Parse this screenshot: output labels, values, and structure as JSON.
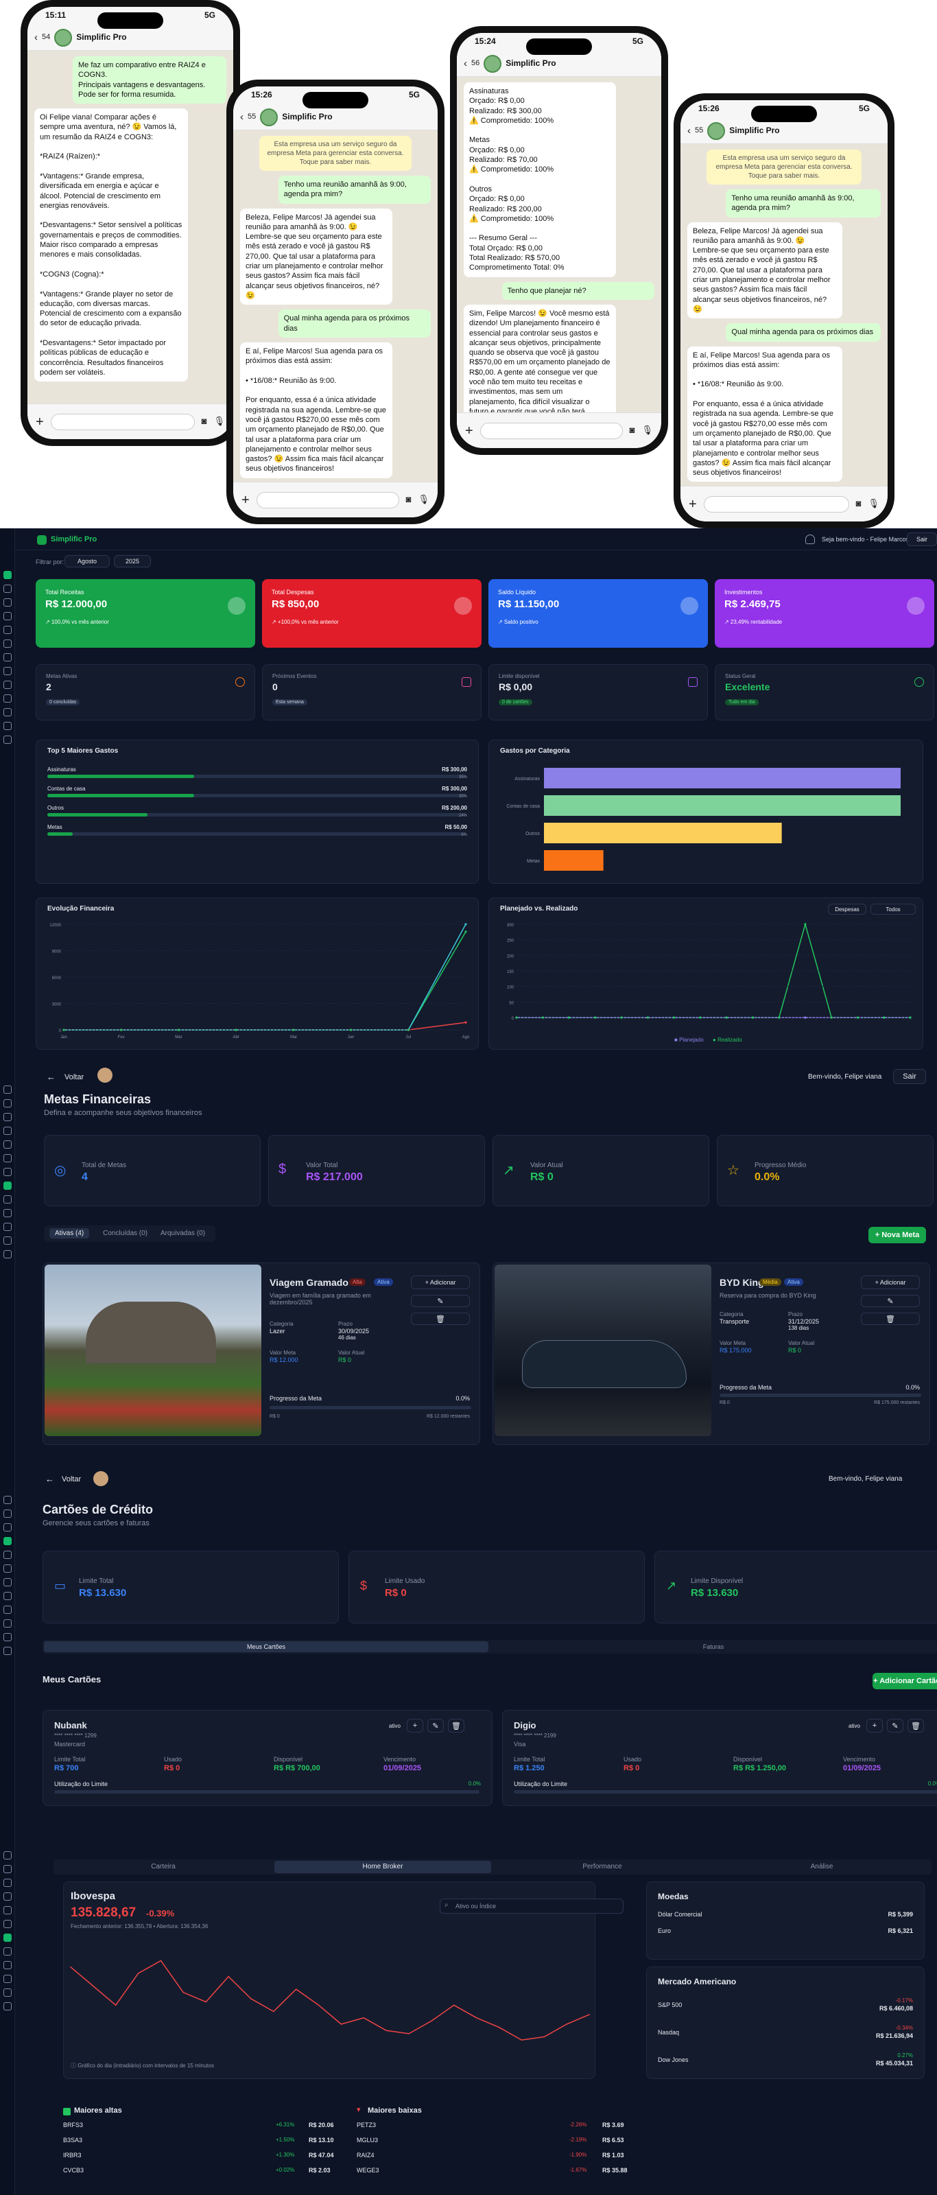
{
  "phones": [
    {
      "time": "15:11",
      "net": "5G",
      "num": "54",
      "name": "Simplific Pro",
      "msgs": [
        {
          "t": "out",
          "x": "Me faz um comparativo entre RAIZ4 e COGN3.\nPrincipais vantagens e desvantagens.\nPode ser for forma resumida."
        },
        {
          "t": "in",
          "x": "Oi Felipe viana! Comparar ações é sempre uma aventura, né? 😉 Vamos lá, um resumão da RAIZ4 e COGN3:\n\n*RAIZ4 (Raízen):*\n\n*Vantagens:* Grande empresa, diversificada em energia e açúcar e álcool. Potencial de crescimento em energias renováveis.\n\n*Desvantagens:* Setor sensível a políticas governamentais e preços de commodities. Maior risco comparado a empresas menores e mais consolidadas.\n\n*COGN3 (Cogna):*\n\n*Vantagens:* Grande player no setor de educação, com diversas marcas. Potencial de crescimento com a expansão do setor de educação privada.\n\n*Desvantagens:* Setor impactado por políticas públicas de educação e concorrência. Resultados financeiros podem ser voláteis."
        }
      ]
    },
    {
      "time": "15:26",
      "net": "5G",
      "num": "55",
      "name": "Simplific Pro",
      "msgs": [
        {
          "t": "sys",
          "x": "Esta empresa usa um serviço seguro da empresa Meta para gerenciar esta conversa. Toque para saber mais."
        },
        {
          "t": "out",
          "x": "Tenho uma reunião amanhã às 9:00, agenda pra mim?"
        },
        {
          "t": "in",
          "x": "Beleza, Felipe Marcos! Já agendei sua reunião para amanhã às 9:00. 😉\nLembre-se que seu orçamento para este mês está zerado e você já gastou R$ 270,00. Que tal usar a plataforma para criar um planejamento e controlar melhor seus gastos? Assim fica mais fácil alcançar seus objetivos financeiros, né? 😉"
        },
        {
          "t": "out",
          "x": "Qual minha agenda para os próximos dias"
        },
        {
          "t": "in",
          "x": "E aí, Felipe Marcos! Sua agenda para os próximos dias está assim:\n\n• *16/08:* Reunião às 9:00.\n\nPor enquanto, essa é a única atividade registrada na sua agenda. Lembre-se que você já gastou R$270,00 esse mês com um orçamento planejado de R$0,00. Que tal usar a plataforma para criar um planejamento e controlar melhor seus gastos? 😉 Assim fica mais fácil alcançar seus objetivos financeiros!"
        }
      ]
    },
    {
      "time": "15:24",
      "net": "5G",
      "num": "56",
      "name": "Simplific Pro",
      "msgs": [
        {
          "t": "in",
          "x": "Assinaturas\n  Orçado: R$ 0,00\n  Realizado: R$ 300,00\n  ⚠️ Comprometido: 100%\n\nMetas\n  Orçado: R$ 0,00\n  Realizado: R$ 70,00\n  ⚠️ Comprometido: 100%\n\nOutros\n  Orçado: R$ 0,00\n  Realizado: R$ 200,00\n  ⚠️ Comprometido: 100%\n\n--- Resumo Geral ---\nTotal Orçado: R$ 0,00\nTotal Realizado: R$ 570,00\nComprometimento Total: 0%"
        },
        {
          "t": "out",
          "x": "Tenho que planejar né?"
        },
        {
          "t": "in",
          "x": "Sim, Felipe Marcos! 😉 Você mesmo está dizendo! Um planejamento financeiro é essencial para controlar seus gastos e alcançar seus objetivos, principalmente quando se observa que você já gastou R$570,00 em um orçamento planejado de R$0,00. A gente até consegue ver que você não tem muito teu receitas e investimentos, mas sem um planejamento, fica difícil visualizar o futuro e garantir que você não terá surpresas desagradáveis. Vamos criar um planejamento na plataforma Simplific para te ajudar a"
        }
      ]
    },
    {
      "time": "15:26",
      "net": "5G",
      "num": "55",
      "name": "Simplific Pro",
      "msgs": [
        {
          "t": "sys",
          "x": "Esta empresa usa um serviço seguro da empresa Meta para gerenciar esta conversa. Toque para saber mais."
        },
        {
          "t": "out",
          "x": "Tenho uma reunião amanhã às 9:00, agenda pra mim?"
        },
        {
          "t": "in",
          "x": "Beleza, Felipe Marcos! Já agendei sua reunião para amanhã às 9:00. 😉\nLembre-se que seu orçamento para este mês está zerado e você já gastou R$ 270,00. Que tal usar a plataforma para criar um planejamento e controlar melhor seus gastos? Assim fica mais fácil alcançar seus objetivos financeiros, né? 😉"
        },
        {
          "t": "out",
          "x": "Qual minha agenda para os próximos dias"
        },
        {
          "t": "in",
          "x": "E aí, Felipe Marcos! Sua agenda para os próximos dias está assim:\n\n• *16/08:* Reunião às 9:00.\n\nPor enquanto, essa é a única atividade registrada na sua agenda. Lembre-se que você já gastou R$270,00 esse mês com um orçamento planejado de R$0,00. Que tal usar a plataforma para criar um planejamento e controlar melhor seus gastos? 😉 Assim fica mais fácil alcançar seus objetivos financeiros!"
        }
      ]
    }
  ],
  "dash": {
    "brand": "Simplific Pro",
    "welcome": "Seja bem-vindo - Felipe Marcos",
    "logout": "Sair",
    "filter_label": "Filtrar por:",
    "month": "Agosto",
    "year": "2025",
    "kpis": [
      {
        "label": "Total Receitas",
        "value": "R$ 12.000,00",
        "note": "↗ 100,0% vs mês anterior",
        "color": "#16a34a"
      },
      {
        "label": "Total Despesas",
        "value": "R$ 850,00",
        "note": "↗ +100,0% vs mês anterior",
        "color": "#e11d2a"
      },
      {
        "label": "Saldo Líquido",
        "value": "R$ 11.150,00",
        "note": "↗ Saldo positivo",
        "color": "#2563eb"
      },
      {
        "label": "Investimentos",
        "value": "R$ 2.469,75",
        "note": "↗ 23,49% rentabilidade",
        "color": "#9333ea"
      }
    ],
    "stats": [
      {
        "label": "Metas Ativas",
        "value": "2",
        "tag": "0 concluídas"
      },
      {
        "label": "Próximos Eventos",
        "value": "0",
        "tag": "Esta semana"
      },
      {
        "label": "Limite disponível",
        "value": "R$ 0,00",
        "tag": "0 de cartões",
        "green": true
      },
      {
        "label": "Status Geral",
        "value": "Excelente",
        "tag": "Tudo em dia",
        "green": true
      }
    ],
    "top_title": "Top 5 Maiores Gastos",
    "top": [
      {
        "name": "Assinaturas",
        "value": "R$ 300,00",
        "pct": "35%",
        "frac": 0.35
      },
      {
        "name": "Contas de casa",
        "value": "R$ 300,00",
        "pct": "35%",
        "frac": 0.35
      },
      {
        "name": "Outros",
        "value": "R$ 200,00",
        "pct": "24%",
        "frac": 0.24
      },
      {
        "name": "Metas",
        "value": "R$ 50,00",
        "pct": "6%",
        "frac": 0.06
      }
    ],
    "cat_title": "Gastos por Categoria",
    "evo_title": "Evolução Financeira",
    "plan_title": "Planejado vs. Realizado",
    "plan_sel1": "Despesas",
    "plan_sel2": "Todos",
    "plan_legend1": "Planejado",
    "plan_legend2": "Realizado"
  },
  "chart_data": [
    {
      "type": "bar",
      "title": "Gastos por Categoria",
      "categories": [
        "Assinaturas",
        "Contas de casa",
        "Outros",
        "Metas"
      ],
      "values": [
        300,
        300,
        200,
        50
      ],
      "colors": [
        "#8b7fe8",
        "#7ed39a",
        "#fccf5a",
        "#f97316"
      ]
    },
    {
      "type": "line",
      "title": "Evolução Financeira",
      "x": [
        "Jan",
        "Fev",
        "Mar",
        "Abr",
        "Mai",
        "Jun",
        "Jul",
        "Ago"
      ],
      "yticks": [
        "12000",
        "9000",
        "6000",
        "3000",
        "0"
      ],
      "ylim": [
        0,
        12000
      ],
      "series": [
        {
          "values": [
            0,
            0,
            0,
            0,
            0,
            0,
            0,
            12000
          ],
          "color": "#3bc6d8"
        },
        {
          "values": [
            0,
            0,
            0,
            0,
            0,
            0,
            0,
            850
          ],
          "color": "#ef4444"
        },
        {
          "values": [
            0,
            0,
            0,
            0,
            0,
            0,
            0,
            11150
          ],
          "color": "#22c55e"
        }
      ]
    },
    {
      "type": "line",
      "title": "Planejado vs. Realizado",
      "ylim": [
        0,
        300
      ],
      "yticks": [
        "300",
        "250",
        "200",
        "150",
        "100",
        "50",
        "0"
      ],
      "series": [
        {
          "name": "Planejado",
          "values": [
            0,
            0,
            0,
            0,
            0,
            0,
            0,
            0,
            0,
            0,
            0,
            0,
            0,
            0,
            0,
            0
          ],
          "color": "#8b7fe8"
        },
        {
          "name": "Realizado",
          "values": [
            0,
            0,
            0,
            0,
            0,
            0,
            0,
            0,
            0,
            0,
            0,
            300,
            0,
            0,
            0,
            0
          ],
          "color": "#22c55e"
        }
      ]
    }
  ],
  "goals": {
    "back": "Voltar",
    "welcome": "Bem-vindo, Felipe viana",
    "logout": "Sair",
    "title": "Metas Financeiras",
    "subtitle": "Defina e acompanhe seus objetivos financeiros",
    "cards": [
      {
        "label": "Total de Metas",
        "value": "4"
      },
      {
        "label": "Valor Total",
        "value": "R$ 217.000"
      },
      {
        "label": "Valor Atual",
        "value": "R$ 0"
      },
      {
        "label": "Progresso Médio",
        "value": "0.0%"
      }
    ],
    "tabs": [
      "Ativas (4)",
      "Concluídas (0)",
      "Arquivadas (0)"
    ],
    "new_btn": "+ Nova Meta",
    "items": [
      {
        "title": "Viagem Gramado",
        "prio": "Alta",
        "status": "Ativa",
        "desc": "Viagem em família para gramado em dezembro/2025",
        "cat_l": "Categoria",
        "cat": "Lazer",
        "prazo_l": "Prazo",
        "prazo": "30/09/2025",
        "dias": "46 dias",
        "vm_l": "Valor Meta",
        "vm": "R$ 12.000",
        "va_l": "Valor Atual",
        "va": "R$ 0",
        "prog_l": "Progresso da Meta",
        "prog": "0.0%",
        "left": "R$ 0",
        "right": "R$ 12.000 restantes",
        "add": "+ Adicionar"
      },
      {
        "title": "BYD King",
        "prio": "Média",
        "status": "Ativa",
        "desc": "Reserva para compra do BYD King",
        "cat_l": "Categoria",
        "cat": "Transporte",
        "prazo_l": "Prazo",
        "prazo": "31/12/2025",
        "dias": "138 dias",
        "vm_l": "Valor Meta",
        "vm": "R$ 175.000",
        "va_l": "Valor Atual",
        "va": "R$ 0",
        "prog_l": "Progresso da Meta",
        "prog": "0.0%",
        "left": "R$ 0",
        "right": "R$ 175.000 restantes",
        "add": "+ Adicionar"
      }
    ]
  },
  "cards": {
    "back": "Voltar",
    "welcome": "Bem-vindo, Felipe viana",
    "title": "Cartões de Crédito",
    "subtitle": "Gerencie seus cartões e faturas",
    "sum": [
      {
        "label": "Limite Total",
        "value": "R$ 13.630"
      },
      {
        "label": "Limite Usado",
        "value": "R$ 0"
      },
      {
        "label": "Limite Disponível",
        "value": "R$ 13.630"
      }
    ],
    "tabs": [
      "Meus Cartões",
      "Faturas"
    ],
    "my": "Meus Cartões",
    "add": "+ Adicionar Cartão",
    "items": [
      {
        "name": "Nubank",
        "num": "**** **** **** 1299",
        "brand": "Mastercard",
        "status": "ativo",
        "lt_l": "Limite Total",
        "lt": "R$ 700",
        "us_l": "Usado",
        "us": "R$ 0",
        "di_l": "Disponível",
        "di": "R$ R$ 700,00",
        "ve_l": "Vencimento",
        "ve": "01/09/2025",
        "util": "Utilização do Limite",
        "pct": "0.0%"
      },
      {
        "name": "Digio",
        "num": "**** **** **** 2199",
        "brand": "Visa",
        "status": "ativo",
        "lt_l": "Limite Total",
        "lt": "R$ 1.250",
        "us_l": "Usado",
        "us": "R$ 0",
        "di_l": "Disponível",
        "di": "R$ R$ 1.250,00",
        "ve_l": "Vencimento",
        "ve": "01/09/2025",
        "util": "Utilização do Limite",
        "pct": "0.0%"
      }
    ]
  },
  "broker": {
    "tabs": [
      "Carteira",
      "Home Broker",
      "Performance",
      "Análise"
    ],
    "index": "Ibovespa",
    "value": "135.828,67",
    "chg": "-0.39%",
    "sub": "Fechamento anterior: 136.355,78 • Abertura: 136.354,36",
    "search_ph": "Ativo ou Índice",
    "foot": "ⓘ Gráfico do dia (intradiário) com intervalos de 15 minutos",
    "moedas": "Moedas",
    "fx": [
      {
        "n": "Dólar Comercial",
        "v": "R$ 5,399"
      },
      {
        "n": "Euro",
        "v": "R$ 6,321"
      }
    ],
    "us": "Mercado Americano",
    "usx": [
      {
        "n": "S&P 500",
        "c": "-0.17%",
        "v": "R$ 6.460,08",
        "neg": true
      },
      {
        "n": "Nasdaq",
        "c": "-0.34%",
        "v": "R$ 21.636,94",
        "neg": true
      },
      {
        "n": "Dow Jones",
        "c": "0.27%",
        "v": "R$ 45.034,31",
        "neg": false
      }
    ],
    "highs": "Maiores altas",
    "lows": "Maiores baixas",
    "hi": [
      {
        "t": "BRFS3",
        "c": "+6.31%",
        "v": "R$ 20.06"
      },
      {
        "t": "B3SA3",
        "c": "+1.50%",
        "v": "R$ 13.10"
      },
      {
        "t": "IRBR3",
        "c": "+1.30%",
        "v": "R$ 47.04"
      },
      {
        "t": "CVCB3",
        "c": "+0.02%",
        "v": "R$ 2.03"
      }
    ],
    "lo": [
      {
        "t": "PETZ3",
        "c": "-2.26%",
        "v": "R$ 3.69"
      },
      {
        "t": "MGLU3",
        "c": "-2.19%",
        "v": "R$ 6.53"
      },
      {
        "t": "RAIZ4",
        "c": "-1.90%",
        "v": "R$ 1.03"
      },
      {
        "t": "WEGE3",
        "c": "-1.67%",
        "v": "R$ 35.88"
      }
    ],
    "ibov": [
      136300,
      136000,
      135700,
      136200,
      136400,
      135900,
      135750,
      136150,
      135800,
      135600,
      135950,
      135700,
      135400,
      135500,
      135300,
      135250,
      135450,
      135700,
      135500,
      135350,
      135150,
      135200,
      135400,
      135550
    ],
    "ibov_ylim": [
      135000,
      136600
    ]
  }
}
